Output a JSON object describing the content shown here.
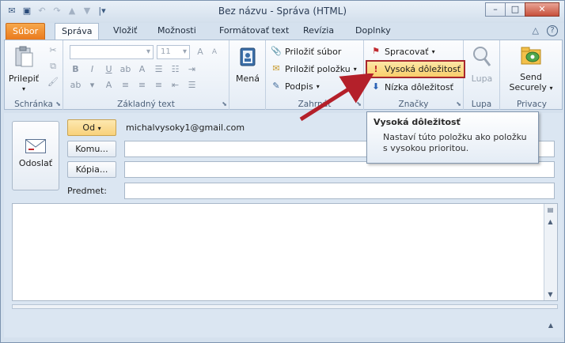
{
  "window": {
    "title": "Bez názvu  -  Správa (HTML)",
    "buttons": {
      "minimize": "–",
      "maximize": "□",
      "close": "✕"
    }
  },
  "qat_icons": [
    "outlook-icon",
    "save-icon",
    "undo-icon",
    "redo-icon",
    "up-icon",
    "down-icon",
    "customize-icon"
  ],
  "tabs": [
    {
      "label": "Súbor",
      "active": false,
      "file": true
    },
    {
      "label": "Správa",
      "active": true
    },
    {
      "label": "Vložiť",
      "active": false
    },
    {
      "label": "Možnosti",
      "active": false
    },
    {
      "label": "Formátovať text",
      "active": false
    },
    {
      "label": "Revízia",
      "active": false
    },
    {
      "label": "Doplnky",
      "active": false
    }
  ],
  "ribbon": {
    "clipboard": {
      "label": "Schránka",
      "paste": "Prilepiť"
    },
    "basic_text": {
      "label": "Základný text",
      "font_size": "11"
    },
    "names": {
      "label": "Mená",
      "button": "Mená"
    },
    "include": {
      "label": "Zahrnúť",
      "attach_file": "Priložiť súbor",
      "attach_item": "Priložiť položku",
      "signature": "Podpis"
    },
    "tags": {
      "label": "Značky",
      "followup": "Spracovať",
      "high_importance": "Vysoká dôležitosť",
      "low_importance": "Nízka dôležitosť"
    },
    "zoom": {
      "label": "Lupa",
      "button": "Lupa"
    },
    "privacy": {
      "label": "Privacy",
      "send_line1": "Send",
      "send_line2": "Securely"
    }
  },
  "tooltip": {
    "title": "Vysoká dôležitosť",
    "body": "Nastaví túto položku ako položku s vysokou prioritou."
  },
  "compose": {
    "send_label": "Odoslať",
    "from_label": "Od",
    "from_value": "michalvysoky1@gmail.com",
    "to_label": "Komu...",
    "cc_label": "Kópia...",
    "subject_label": "Predmet:"
  },
  "colors": {
    "file_tab": "#e9781b",
    "highlight_border": "#a8262c",
    "arrow": "#b4202a"
  }
}
